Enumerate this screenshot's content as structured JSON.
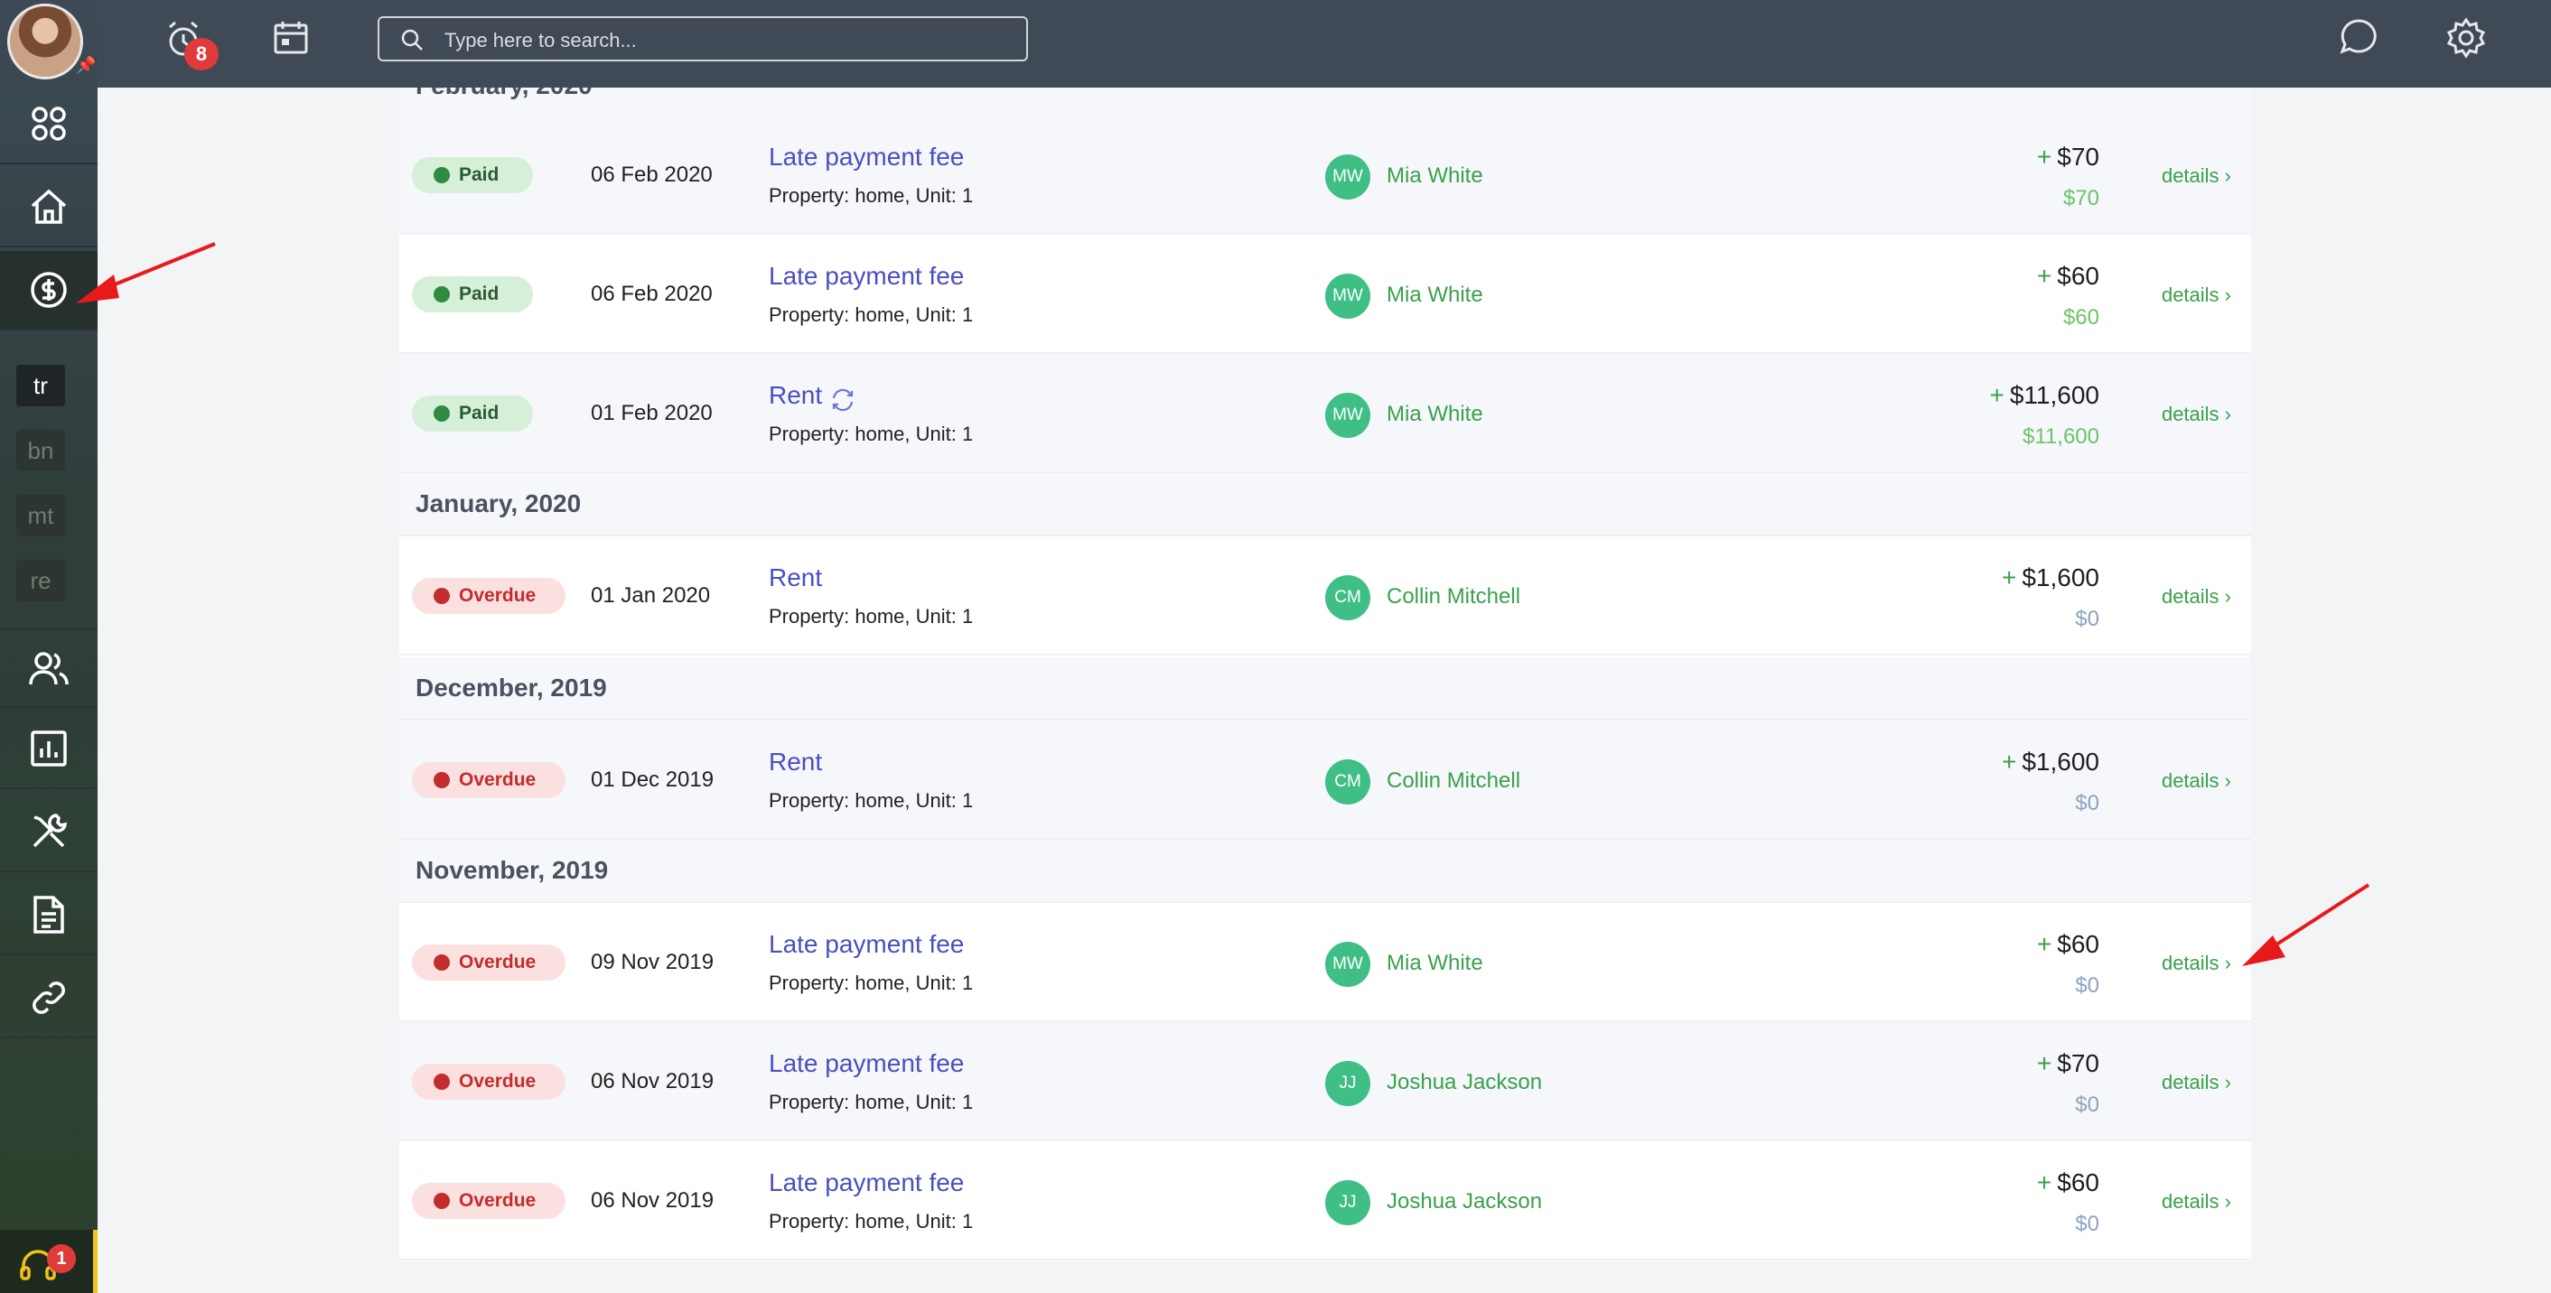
{
  "header": {
    "notifications_count": "8",
    "search_placeholder": "Type here to search..."
  },
  "sidebar": {
    "chips": [
      "tr",
      "bn",
      "mt",
      "re"
    ],
    "help_count": "1"
  },
  "months": {
    "feb": "February, 2020",
    "jan": "January, 2020",
    "dec": "December, 2019",
    "nov": "November, 2019"
  },
  "details_label": "details",
  "rows": [
    {
      "status": "Paid",
      "date": "06 Feb 2020",
      "title": "Late payment fee",
      "property": "Property: home, Unit: 1",
      "initials": "MW",
      "tenant": "Mia White",
      "amount": "$70",
      "paid": "$70"
    },
    {
      "status": "Paid",
      "date": "06 Feb 2020",
      "title": "Late payment fee",
      "property": "Property: home, Unit: 1",
      "initials": "MW",
      "tenant": "Mia White",
      "amount": "$60",
      "paid": "$60"
    },
    {
      "status": "Paid",
      "date": "01 Feb 2020",
      "title": "Rent",
      "property": "Property: home, Unit: 1",
      "initials": "MW",
      "tenant": "Mia White",
      "amount": "$11,600",
      "paid": "$11,600"
    },
    {
      "status": "Overdue",
      "date": "01 Jan 2020",
      "title": "Rent",
      "property": "Property: home, Unit: 1",
      "initials": "CM",
      "tenant": "Collin Mitchell",
      "amount": "$1,600",
      "paid": "$0"
    },
    {
      "status": "Overdue",
      "date": "01 Dec 2019",
      "title": "Rent",
      "property": "Property: home, Unit: 1",
      "initials": "CM",
      "tenant": "Collin Mitchell",
      "amount": "$1,600",
      "paid": "$0"
    },
    {
      "status": "Overdue",
      "date": "09 Nov 2019",
      "title": "Late payment fee",
      "property": "Property: home, Unit: 1",
      "initials": "MW",
      "tenant": "Mia White",
      "amount": "$60",
      "paid": "$0"
    },
    {
      "status": "Overdue",
      "date": "06 Nov 2019",
      "title": "Late payment fee",
      "property": "Property: home, Unit: 1",
      "initials": "JJ",
      "tenant": "Joshua Jackson",
      "amount": "$70",
      "paid": "$0"
    },
    {
      "status": "Overdue",
      "date": "06 Nov 2019",
      "title": "Late payment fee",
      "property": "Property: home, Unit: 1",
      "initials": "JJ",
      "tenant": "Joshua Jackson",
      "amount": "$60",
      "paid": "$0"
    }
  ],
  "colors": {
    "accent_green": "#3aa14a",
    "link_purple": "#4a4fc0",
    "overdue_red": "#c22d2d",
    "annotation_red": "#e8191b"
  }
}
